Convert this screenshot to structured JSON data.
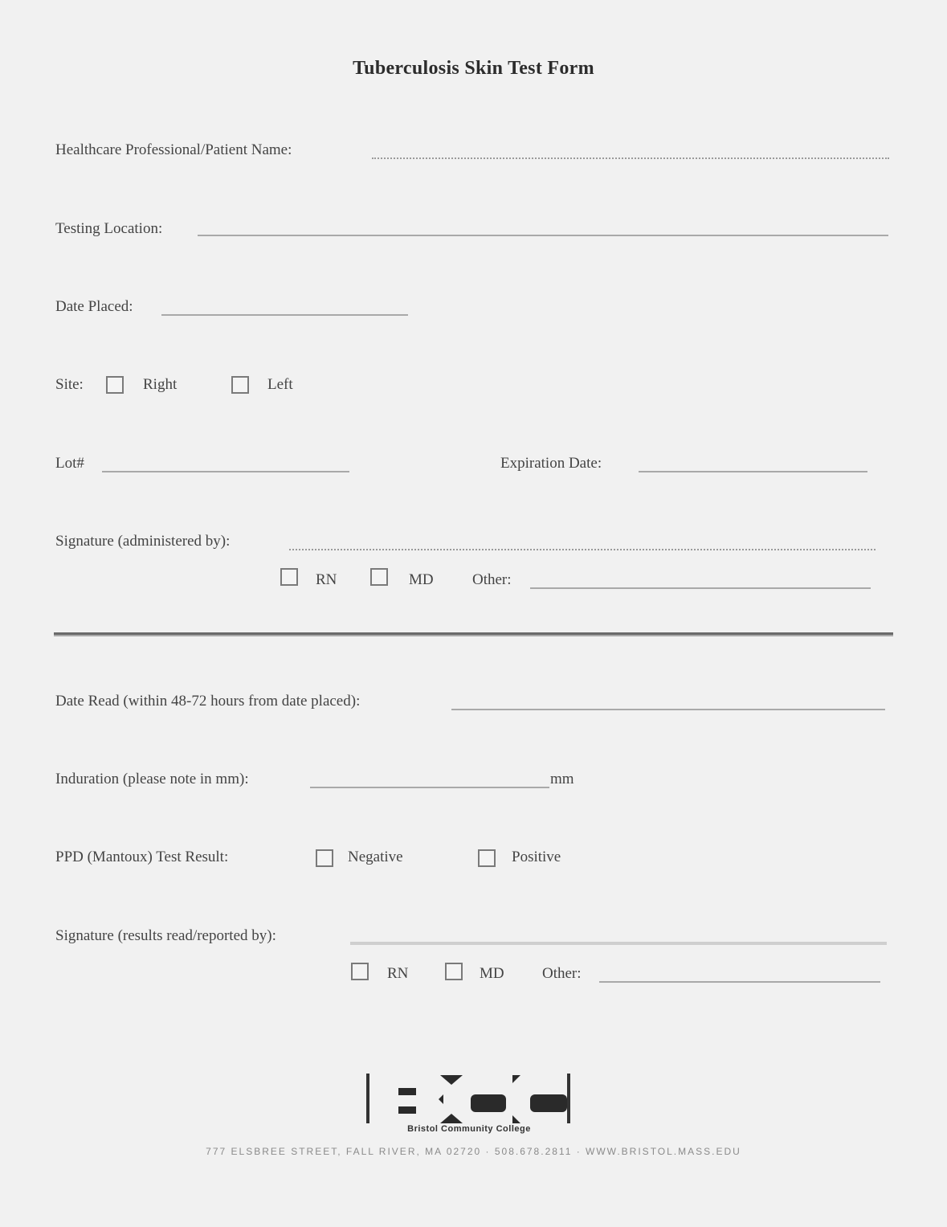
{
  "title": "Tuberculosis Skin Test Form",
  "placement": {
    "name_label": "Healthcare Professional/Patient Name:",
    "location_label": "Testing Location:",
    "date_placed_label": "Date Placed:",
    "site_label": "Site:",
    "site_options": [
      "Right",
      "Left"
    ],
    "lot_label": "Lot#",
    "expiration_label": "Expiration Date:",
    "signature_label": "Signature (administered by):",
    "credential_options": [
      "RN",
      "MD"
    ],
    "other_label": "Other:"
  },
  "reading": {
    "date_read_label": "Date Read (within 48-72 hours from date placed):",
    "induration_label": "Induration (please note in mm):",
    "induration_unit": "mm",
    "result_label": "PPD (Mantoux) Test Result:",
    "result_options": [
      "Negative",
      "Positive"
    ],
    "signature_label": "Signature (results read/reported by):",
    "credential_options": [
      "RN",
      "MD"
    ],
    "other_label": "Other:"
  },
  "footer": {
    "logo_text": "Bristol Community College",
    "address": "777 ELSBREE STREET, FALL RIVER, MA 02720 · 508.678.2811 · WWW.BRISTOL.MASS.EDU"
  }
}
